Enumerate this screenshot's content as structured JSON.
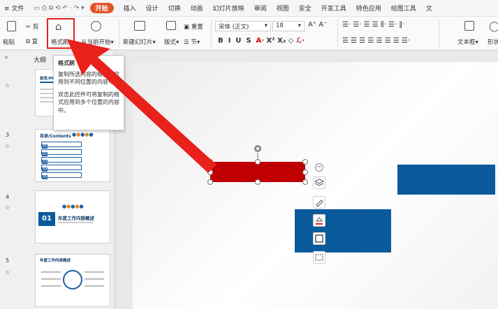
{
  "menubar": {
    "file": "≡ 文件",
    "start": "开始",
    "items": [
      "插入",
      "设计",
      "切换",
      "动画",
      "幻灯片放映",
      "审阅",
      "视图",
      "安全",
      "开发工具",
      "特色应用",
      "绘图工具",
      "文"
    ]
  },
  "ribbon": {
    "paste": "粘贴",
    "cut": "剪",
    "copy": "复",
    "format_painter": "格式刷",
    "play_from_current": "从当前开始",
    "new_slide": "新建幻灯片",
    "layout": "版式",
    "section": "节",
    "reset": "重置",
    "font_name": "宋体 (正文)",
    "font_size": "18",
    "text_box": "文本框",
    "shape": "形状"
  },
  "tooltip": {
    "title": "格式刷",
    "line1": "复制所选内容的格式，应用到不同位置的内容中。",
    "line2": "双击此控件可将复制的格式应用到多个位置的内容中。"
  },
  "left_panel": {
    "outline_tab": "大纲",
    "slides": [
      {
        "number": "",
        "heading": "前言/PREFACE"
      },
      {
        "number": "3",
        "heading": "目录/Contents"
      },
      {
        "number": "4",
        "heading": "年度工作内容概述"
      },
      {
        "number": "5",
        "heading": "年度工作内容概述"
      }
    ],
    "slide3_items": [
      "01",
      "02",
      "03",
      "04",
      "05"
    ],
    "slide4_num": "01"
  },
  "colors": {
    "accent_red": "#e8211b",
    "shape_red": "#c00000",
    "shape_blue": "#0b5a9c",
    "start_tab": "#e4542b"
  }
}
